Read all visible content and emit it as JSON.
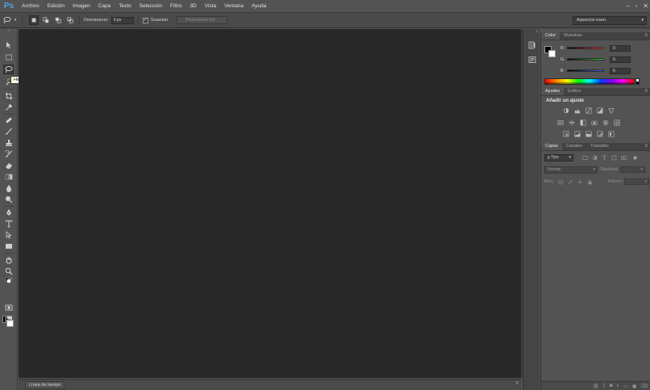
{
  "app": {
    "logo": "Ps"
  },
  "menu": {
    "items": [
      "Archivo",
      "Edición",
      "Imagen",
      "Capa",
      "Texto",
      "Selección",
      "Filtro",
      "3D",
      "Vista",
      "Ventana",
      "Ayuda"
    ]
  },
  "window_controls": {
    "minimize": "–",
    "maximize": "▫",
    "close": "✕"
  },
  "options": {
    "feather_label": "Desvanecer:",
    "feather_value": "0 px",
    "antialias_label": "Suavizar",
    "antialias_checked": "✓",
    "refine_edge": "Perfeccionar bor...",
    "workspace": "Aspectos esen."
  },
  "tooltip": {
    "text": "Herramienta Lazo (L)"
  },
  "timeline": {
    "tab": "Línea de tiempo",
    "menu": "≡"
  },
  "color_panel": {
    "tabs": [
      "Color",
      "Muestras"
    ],
    "menu": "≡",
    "sliders": [
      {
        "label": "R",
        "value": "0",
        "color": "#ff3b3b"
      },
      {
        "label": "G",
        "value": "0",
        "color": "#3bd23b"
      },
      {
        "label": "B",
        "value": "0",
        "color": "#3b6bff"
      }
    ]
  },
  "adjust_panel": {
    "tabs": [
      "Ajustes",
      "Estilos"
    ],
    "menu": "≡",
    "title": "Añadir un ajuste"
  },
  "layers_panel": {
    "tabs": [
      "Capas",
      "Canales",
      "Trazados"
    ],
    "menu": "≡",
    "filter": "ρ Tipo",
    "blend_mode": "Normal",
    "opacity_label": "Opacidad:",
    "lock_label": "Bloq.:",
    "fill_label": "Relleno:"
  }
}
